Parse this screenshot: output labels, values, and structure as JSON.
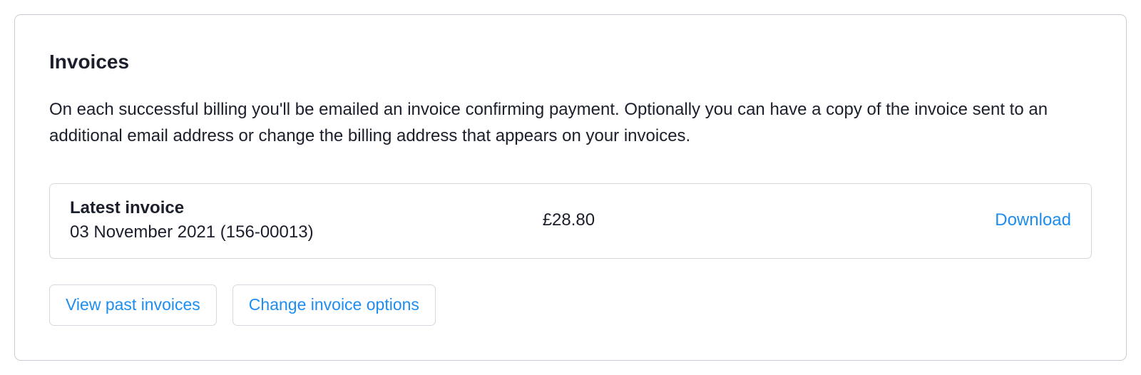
{
  "panel": {
    "title": "Invoices",
    "description": "On each successful billing you'll be emailed an invoice confirming payment. Optionally you can have a copy of the invoice sent to an additional email address or change the billing address that appears on your invoices."
  },
  "latest_invoice": {
    "label": "Latest invoice",
    "date_line": "03 November 2021 (156-00013)",
    "amount": "£28.80",
    "download_label": "Download"
  },
  "actions": {
    "view_past": "View past invoices",
    "change_options": "Change invoice options"
  }
}
